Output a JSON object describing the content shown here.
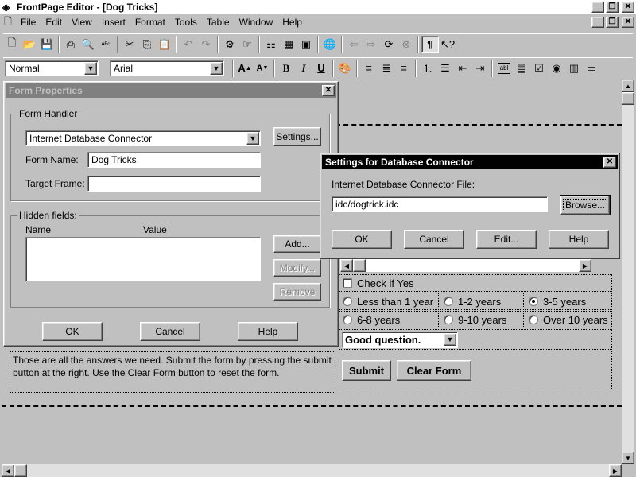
{
  "app": {
    "title": "FrontPage Editor - [Dog Tricks]",
    "menu": [
      "File",
      "Edit",
      "View",
      "Insert",
      "Format",
      "Tools",
      "Table",
      "Window",
      "Help"
    ]
  },
  "format_bar": {
    "style": "Normal",
    "font": "Arial"
  },
  "page": {
    "paragraph": "Those are all the answers we need. Submit the form by pressing the submit button at the right. Use the Clear Form button to reset the form.",
    "checkbox_label": "Check if Yes",
    "radios": [
      {
        "label": "Less than 1 year",
        "checked": false
      },
      {
        "label": "1-2 years",
        "checked": false
      },
      {
        "label": "3-5 years",
        "checked": true
      },
      {
        "label": "6-8 years",
        "checked": false
      },
      {
        "label": "9-10 years",
        "checked": false
      },
      {
        "label": "Over 10 years",
        "checked": false
      }
    ],
    "dropdown_value": "Good question.",
    "submit_label": "Submit",
    "clear_label": "Clear Form"
  },
  "form_properties": {
    "title": "Form Properties",
    "handler_group": "Form Handler",
    "handler_value": "Internet Database Connector",
    "settings_button": "Settings...",
    "form_name_label": "Form Name:",
    "form_name_value": "Dog Tricks",
    "target_frame_label": "Target Frame:",
    "target_frame_value": "",
    "hidden_group": "Hidden fields:",
    "col_name": "Name",
    "col_value": "Value",
    "add_button": "Add...",
    "modify_button": "Modify...",
    "remove_button": "Remove",
    "ok": "OK",
    "cancel": "Cancel",
    "help": "Help"
  },
  "db_settings": {
    "title": "Settings for Database Connector",
    "file_label": "Internet Database Connector File:",
    "file_value": "idc/dogtrick.idc",
    "browse": "Browse...",
    "ok": "OK",
    "cancel": "Cancel",
    "edit": "Edit...",
    "help": "Help"
  }
}
